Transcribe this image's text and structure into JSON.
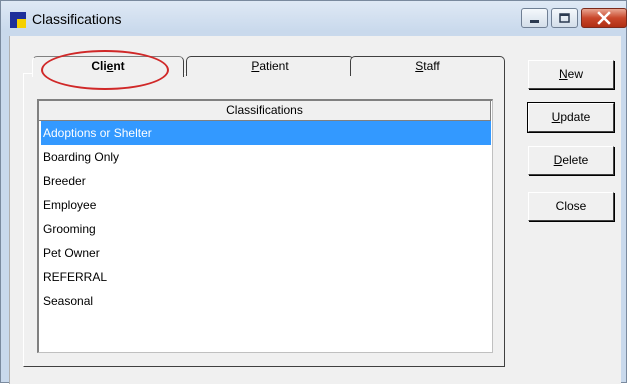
{
  "window": {
    "title": "Classifications",
    "colors": {
      "title_bg": "#c9d9ec",
      "close_button": "#c9472b",
      "selection": "#3399ff",
      "annotation": "#d02828"
    }
  },
  "tabs": [
    {
      "pre": "Cli",
      "key": "e",
      "post": "nt",
      "active": true
    },
    {
      "pre": "",
      "key": "P",
      "post": "atient",
      "active": false
    },
    {
      "pre": "",
      "key": "S",
      "post": "taff",
      "active": false
    }
  ],
  "list": {
    "header": "Classifications",
    "items": [
      "Adoptions or Shelter",
      "Boarding Only",
      "Breeder",
      "Employee",
      "Grooming",
      "Pet Owner",
      "REFERRAL",
      "Seasonal"
    ],
    "selected_index": 0
  },
  "buttons": [
    {
      "pre": "",
      "key": "N",
      "post": "ew"
    },
    {
      "pre": "",
      "key": "U",
      "post": "pdate"
    },
    {
      "pre": "",
      "key": "D",
      "post": "elete"
    },
    {
      "pre": "Close",
      "key": "",
      "post": ""
    }
  ],
  "icons": {
    "app": "app-icon",
    "minimize": "minimize-icon",
    "maximize": "maximize-icon",
    "close": "close-icon"
  }
}
